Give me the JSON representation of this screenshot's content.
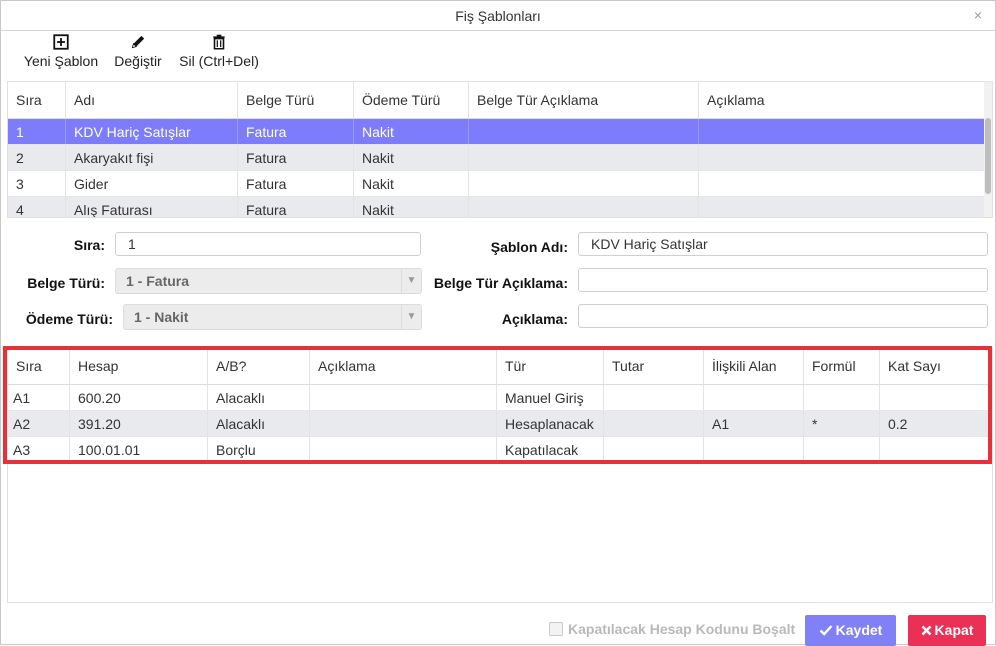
{
  "window": {
    "title": "Fiş Şablonları",
    "close_glyph": "×"
  },
  "toolbar": {
    "new_label": "Yeni Şablon",
    "edit_label": "Değiştir",
    "delete_label": "Sil (Ctrl+Del)",
    "icons": [
      "plus-square-icon",
      "pencil-icon",
      "trash-icon"
    ]
  },
  "templates_table": {
    "columns": [
      "Sıra",
      "Adı",
      "Belge Türü",
      "Ödeme Türü",
      "Belge Tür Açıklama",
      "Açıklama"
    ],
    "rows": [
      [
        "1",
        "KDV Hariç Satışlar",
        "Fatura",
        "Nakit",
        "",
        ""
      ],
      [
        "2",
        "Akaryakıt fişi",
        "Fatura",
        "Nakit",
        "",
        ""
      ],
      [
        "3",
        "Gider",
        "Fatura",
        "Nakit",
        "",
        ""
      ],
      [
        "4",
        "Alış Faturası",
        "Fatura",
        "Nakit",
        "",
        ""
      ]
    ],
    "selected_row_color": "#7d7dfb"
  },
  "form": {
    "sira_label": "Sıra:",
    "sira_value": "1",
    "belge_turu_label": "Belge Türü:",
    "belge_turu_value": "1 - Fatura",
    "odeme_turu_label": "Ödeme Türü:",
    "odeme_turu_value": "1 - Nakit",
    "sablon_adi_label": "Şablon Adı:",
    "sablon_adi_value": "KDV Hariç Satışlar",
    "belge_tur_aciklama_label": "Belge Tür Açıklama:",
    "belge_tur_aciklama_value": "",
    "aciklama_label": "Açıklama:",
    "aciklama_value": ""
  },
  "lines_table": {
    "columns": [
      "Sıra",
      "Hesap",
      "A/B?",
      "Açıklama",
      "Tür",
      "Tutar",
      "İlişkili Alan",
      "Formül",
      "Kat Sayı"
    ],
    "rows": [
      [
        "A1",
        "600.20",
        "Alacaklı",
        "",
        "Manuel Giriş",
        "",
        "",
        "",
        ""
      ],
      [
        "A2",
        "391.20",
        "Alacaklı",
        "",
        "Hesaplanacak",
        "",
        "A1",
        "*",
        "0.2"
      ],
      [
        "A3",
        "100.01.01",
        "Borçlu",
        "",
        "Kapatılacak",
        "",
        "",
        "",
        ""
      ]
    ],
    "highlight_color": "#e53238"
  },
  "footer": {
    "checkbox_label": "Kapatılacak Hesap Kodunu Boşalt",
    "save_label": "Kaydet",
    "close_label": "Kapat",
    "save_color": "#8181f7",
    "close_color": "#ea3155"
  }
}
